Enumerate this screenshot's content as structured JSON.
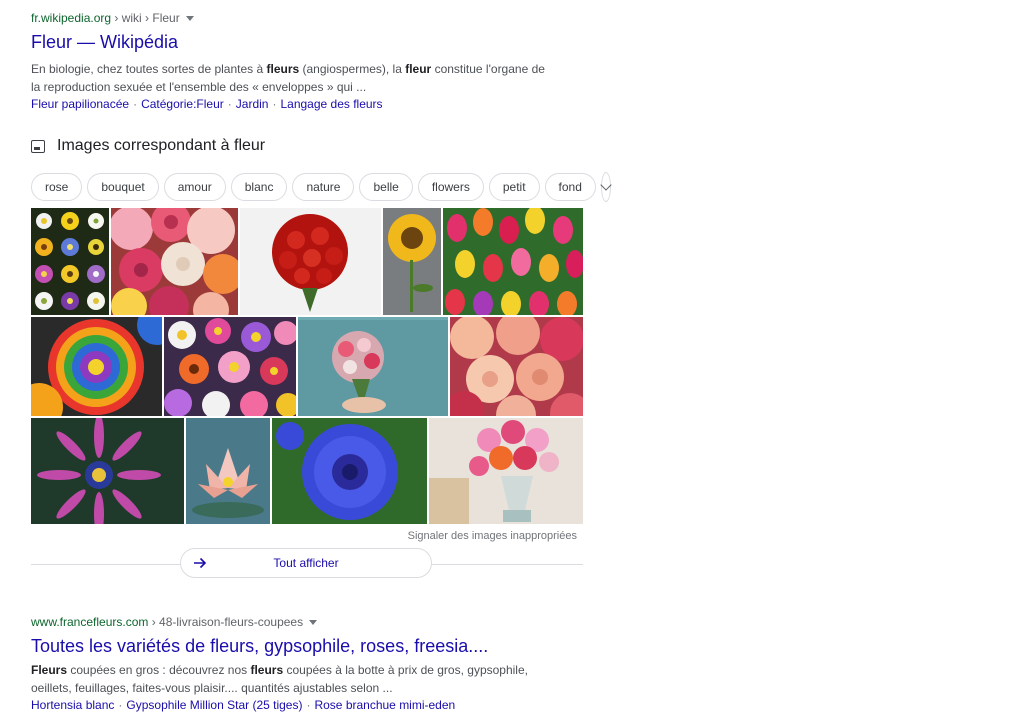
{
  "result1": {
    "domain": "fr.wikipedia.org",
    "path": " › wiki › Fleur",
    "title": "Fleur — Wikipédia",
    "snippet_parts": [
      {
        "t": "En biologie, chez toutes sortes de plantes à "
      },
      {
        "t": "fleurs",
        "b": true
      },
      {
        "t": " (angiospermes), la "
      },
      {
        "t": "fleur",
        "b": true
      },
      {
        "t": " constitue l'organe de la reproduction sexuée et l'ensemble des « enveloppes » qui ..."
      }
    ],
    "sitelinks": [
      "Fleur papilionacée",
      "Catégorie:Fleur",
      "Jardin",
      "Langage des fleurs"
    ]
  },
  "images": {
    "heading": "Images correspondant à fleur",
    "chips": [
      "rose",
      "bouquet",
      "amour",
      "blanc",
      "nature",
      "belle",
      "flowers",
      "petit",
      "fond"
    ],
    "report": "Signaler des images inappropriées",
    "show_all": "Tout afficher"
  },
  "result2": {
    "domain": "www.francefleurs.com",
    "path": " › 48-livraison-fleurs-coupees",
    "title": "Toutes les variétés de fleurs, gypsophile, roses, freesia....",
    "snippet_parts": [
      {
        "t": "Fleurs",
        "b": true
      },
      {
        "t": " coupées en gros : découvrez nos "
      },
      {
        "t": "fleurs",
        "b": true
      },
      {
        "t": " coupées à la botte à prix de gros, gypsophile, oeillets, feuillages, faites-vous plaisir.... quantités ajustables selon ..."
      }
    ],
    "sitelinks": [
      "Hortensia blanc",
      "Gypsophile Million Star (25 tiges)",
      "Rose branchue mimi-eden"
    ]
  },
  "colors": {
    "link": "#1a0dab",
    "url_green": "#0d652d",
    "snippet": "#4d5156"
  }
}
